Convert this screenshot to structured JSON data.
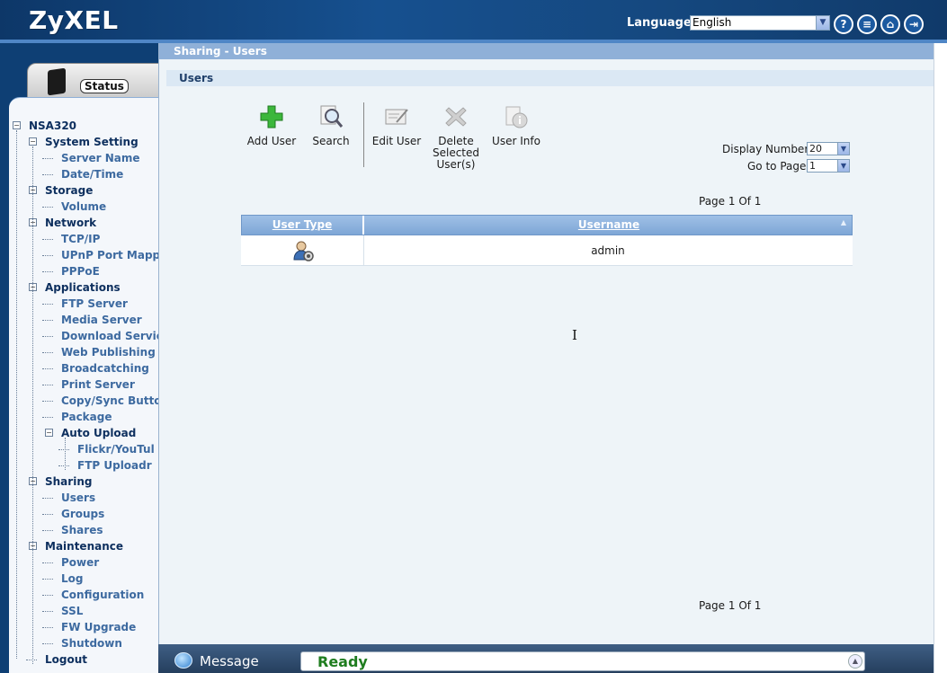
{
  "header": {
    "logo": "ZyXEL",
    "language_label": "Language:",
    "language_value": "English",
    "icons": [
      "help-icon",
      "doc-icon",
      "home-icon",
      "logout-icon"
    ]
  },
  "sidebar": {
    "status_label": "Status",
    "tree": [
      {
        "label": "NSA320",
        "level": 0,
        "expander": "-"
      },
      {
        "label": "System Setting",
        "level": 1,
        "expander": "-"
      },
      {
        "label": "Server Name",
        "level": 2
      },
      {
        "label": "Date/Time",
        "level": 2
      },
      {
        "label": "Storage",
        "level": 1,
        "expander": "-"
      },
      {
        "label": "Volume",
        "level": 2
      },
      {
        "label": "Network",
        "level": 1,
        "expander": "-"
      },
      {
        "label": "TCP/IP",
        "level": 2
      },
      {
        "label": "UPnP Port Mappi",
        "level": 2
      },
      {
        "label": "PPPoE",
        "level": 2
      },
      {
        "label": "Applications",
        "level": 1,
        "expander": "-"
      },
      {
        "label": "FTP Server",
        "level": 2
      },
      {
        "label": "Media Server",
        "level": 2
      },
      {
        "label": "Download Servic",
        "level": 2
      },
      {
        "label": "Web Publishing",
        "level": 2
      },
      {
        "label": "Broadcatching",
        "level": 2
      },
      {
        "label": "Print Server",
        "level": 2
      },
      {
        "label": "Copy/Sync Butto",
        "level": 2
      },
      {
        "label": "Package",
        "level": 2
      },
      {
        "label": "Auto Upload",
        "level": 2,
        "expander": "-",
        "dark": true
      },
      {
        "label": "Flickr/YouTul",
        "level": 3
      },
      {
        "label": "FTP Uploadr",
        "level": 3
      },
      {
        "label": "Sharing",
        "level": 1,
        "expander": "-"
      },
      {
        "label": "Users",
        "level": 2
      },
      {
        "label": "Groups",
        "level": 2
      },
      {
        "label": "Shares",
        "level": 2
      },
      {
        "label": "Maintenance",
        "level": 1,
        "expander": "-"
      },
      {
        "label": "Power",
        "level": 2
      },
      {
        "label": "Log",
        "level": 2
      },
      {
        "label": "Configuration",
        "level": 2
      },
      {
        "label": "SSL",
        "level": 2
      },
      {
        "label": "FW Upgrade",
        "level": 2
      },
      {
        "label": "Shutdown",
        "level": 2
      },
      {
        "label": "Logout",
        "level": 1
      }
    ]
  },
  "main": {
    "breadcrumb": "Sharing - Users",
    "section_title": "Users",
    "toolbar": {
      "add_user": "Add User",
      "search": "Search",
      "edit_user": "Edit User",
      "delete_line1": "Delete",
      "delete_line2": "Selected",
      "delete_line3": "User(s)",
      "user_info": "User Info"
    },
    "display_number_label": "Display Number",
    "display_number_value": "20",
    "go_to_page_label": "Go to Page",
    "go_to_page_value": "1",
    "page_info_top": "Page 1 Of 1",
    "page_info_bottom": "Page 1 Of 1",
    "table": {
      "columns": [
        "User Type",
        "Username"
      ],
      "rows": [
        {
          "user_type_icon": "admin-user-icon",
          "username": "admin"
        }
      ]
    }
  },
  "footer": {
    "message_label": "Message",
    "status": "Ready"
  },
  "colors": {
    "header_bg": "#16508f",
    "sidebar_bg": "#0e3f74",
    "accent_blue": "#8fb0d8",
    "ready_green": "#1f7d1f"
  }
}
